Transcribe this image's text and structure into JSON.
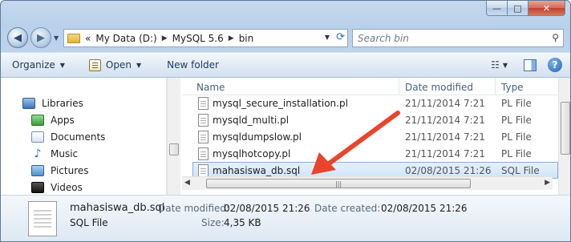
{
  "window": {
    "min_glyph": "—",
    "max_glyph": "□",
    "close_glyph": "✕"
  },
  "address": {
    "overflow": "«",
    "crumbs": [
      "My Data (D:)",
      "MySQL 5.6",
      "bin"
    ]
  },
  "search": {
    "placeholder": "Search bin"
  },
  "toolbar": {
    "organize": "Organize",
    "open": "Open",
    "new_folder": "New folder"
  },
  "nav": {
    "items": [
      {
        "label": "Libraries",
        "icon": "libraries-icon"
      },
      {
        "label": "Apps",
        "icon": "apps-icon"
      },
      {
        "label": "Documents",
        "icon": "documents-icon"
      },
      {
        "label": "Music",
        "icon": "music-icon"
      },
      {
        "label": "Pictures",
        "icon": "pictures-icon"
      },
      {
        "label": "Videos",
        "icon": "videos-icon"
      }
    ]
  },
  "columns": {
    "name": "Name",
    "date": "Date modified",
    "type": "Type"
  },
  "files": [
    {
      "name": "mysql_secure_installation.pl",
      "date": "21/11/2014 7:21",
      "type": "PL File"
    },
    {
      "name": "mysqld_multi.pl",
      "date": "21/11/2014 7:21",
      "type": "PL File"
    },
    {
      "name": "mysqldumpslow.pl",
      "date": "21/11/2014 7:21",
      "type": "PL File"
    },
    {
      "name": "mysqlhotcopy.pl",
      "date": "21/11/2014 7:21",
      "type": "PL File"
    },
    {
      "name": "mahasiswa_db.sql",
      "date": "02/08/2015 21:26",
      "type": "SQL File"
    }
  ],
  "details": {
    "name": "mahasiswa_db.sql",
    "type": "SQL File",
    "modified_label": "Date modified:",
    "modified": "02/08/2015 21:26",
    "created_label": "Date created:",
    "created": "02/08/2015 21:26",
    "size_label": "Size:",
    "size": "4,35 KB"
  },
  "colors": {
    "selection": "#cfe5f8",
    "annotation_arrow": "#e8452c"
  }
}
